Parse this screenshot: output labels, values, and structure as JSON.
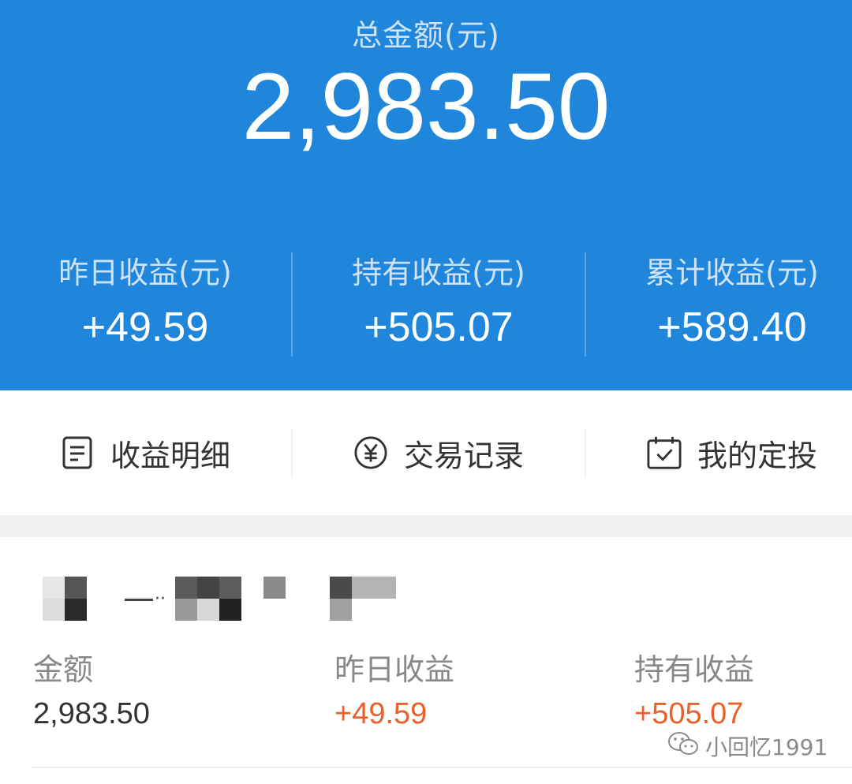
{
  "header": {
    "total_label": "总金额(元)",
    "total_amount": "2,983.50",
    "stats": [
      {
        "label": "昨日收益(元)",
        "value": "+49.59"
      },
      {
        "label": "持有收益(元)",
        "value": "+505.07"
      },
      {
        "label": "累计收益(元)",
        "value": "+589.40"
      }
    ]
  },
  "actions": [
    {
      "label": "收益明细",
      "icon": "document-icon"
    },
    {
      "label": "交易记录",
      "icon": "yen-circle-icon"
    },
    {
      "label": "我的定投",
      "icon": "calendar-check-icon"
    }
  ],
  "holding": {
    "columns": [
      {
        "label": "金额",
        "value": "2,983.50"
      },
      {
        "label": "昨日收益",
        "value": "+49.59"
      },
      {
        "label": "持有收益",
        "value": "+505.07"
      }
    ]
  },
  "watermark": {
    "text": "小回忆1991",
    "icon": "wechat-icon"
  },
  "colors": {
    "header_blue": "#1f86db",
    "positive_red": "#e9602c",
    "text_dark": "#333333",
    "text_gray": "#888888"
  }
}
